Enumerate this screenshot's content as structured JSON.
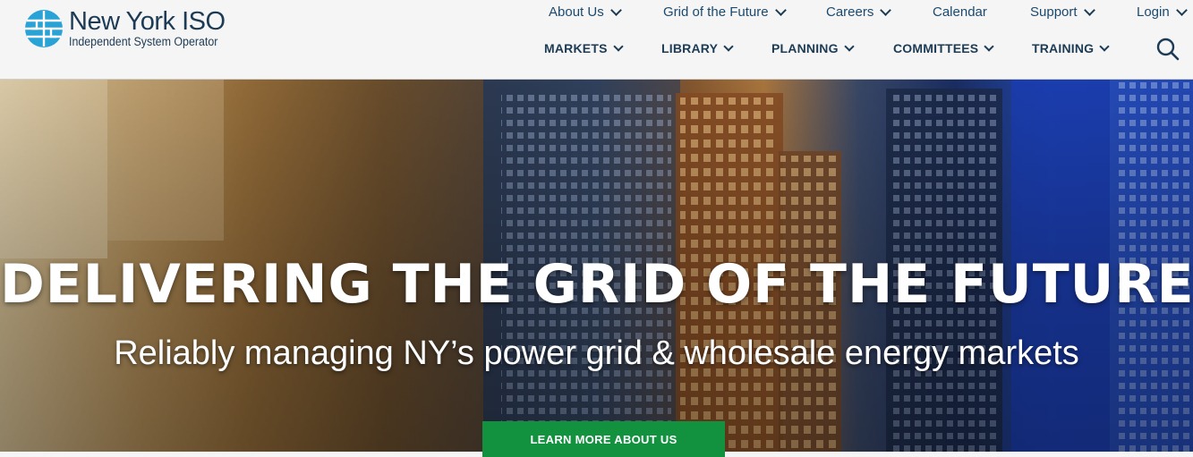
{
  "brand": {
    "title": "New York ISO",
    "subtitle": "Independent System Operator",
    "accent": "#29a3d6",
    "text_color": "#1e3b55"
  },
  "utility_nav": [
    {
      "label": "About Us",
      "has_menu": true
    },
    {
      "label": "Grid of the Future",
      "has_menu": true
    },
    {
      "label": "Careers",
      "has_menu": true
    },
    {
      "label": "Calendar",
      "has_menu": false
    },
    {
      "label": "Support",
      "has_menu": true
    },
    {
      "label": "Login",
      "has_menu": true
    }
  ],
  "main_nav": [
    {
      "label": "MARKETS"
    },
    {
      "label": "LIBRARY"
    },
    {
      "label": "PLANNING"
    },
    {
      "label": "COMMITTEES"
    },
    {
      "label": "TRAINING"
    }
  ],
  "search": {
    "icon": "search-icon"
  },
  "hero": {
    "title": "DELIVERING THE GRID OF THE FUTURE",
    "subtitle": "Reliably managing NY’s power grid & wholesale energy markets",
    "cta_label": "LEARN MORE ABOUT US",
    "cta_color": "#12923f"
  }
}
